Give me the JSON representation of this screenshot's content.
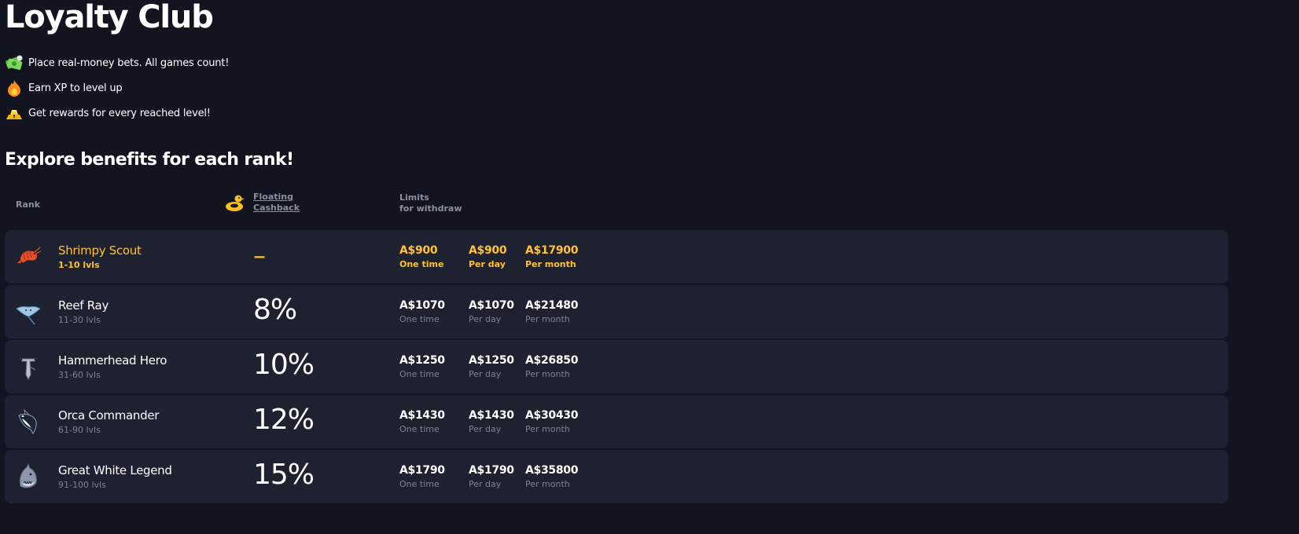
{
  "page": {
    "title": "Loyalty Club",
    "features": [
      {
        "icon": "money-stack-icon",
        "text": "Place real-money bets. All games count!"
      },
      {
        "icon": "flame-icon",
        "text": "Earn XP to level up"
      },
      {
        "icon": "gold-bars-icon",
        "text": "Get rewards for every reached level!"
      }
    ],
    "subtitle": "Explore benefits for each rank!"
  },
  "table": {
    "headers": {
      "rank": "Rank",
      "cashback_line1": "Floating",
      "cashback_line2": "Cashback",
      "limits_line1": "Limits",
      "limits_line2": "for withdraw"
    },
    "rows": [
      {
        "icon": "shrimp-icon",
        "name": "Shrimpy Scout",
        "levels": "1-10 lvls",
        "cashback": "–",
        "one_time": "A$900",
        "one_time_label": "One time",
        "per_day": "A$900",
        "per_day_label": "Per day",
        "per_month": "A$17900",
        "per_month_label": "Per month",
        "active": true
      },
      {
        "icon": "stingray-icon",
        "name": "Reef Ray",
        "levels": "11-30 lvls",
        "cashback": "8%",
        "one_time": "A$1070",
        "one_time_label": "One time",
        "per_day": "A$1070",
        "per_day_label": "Per day",
        "per_month": "A$21480",
        "per_month_label": "Per month"
      },
      {
        "icon": "hammerhead-shark-icon",
        "name": "Hammerhead Hero",
        "levels": "31-60 lvls",
        "cashback": "10%",
        "one_time": "A$1250",
        "one_time_label": "One time",
        "per_day": "A$1250",
        "per_day_label": "Per day",
        "per_month": "A$26850",
        "per_month_label": "Per month"
      },
      {
        "icon": "orca-icon",
        "name": "Orca Commander",
        "levels": "61-90 lvls",
        "cashback": "12%",
        "one_time": "A$1430",
        "one_time_label": "One time",
        "per_day": "A$1430",
        "per_day_label": "Per day",
        "per_month": "A$30430",
        "per_month_label": "Per month"
      },
      {
        "icon": "great-white-shark-icon",
        "name": "Great White Legend",
        "levels": "91-100 lvls",
        "cashback": "15%",
        "one_time": "A$1790",
        "one_time_label": "One time",
        "per_day": "A$1790",
        "per_day_label": "Per day",
        "per_month": "A$35800",
        "per_month_label": "Per month"
      }
    ]
  },
  "colors": {
    "background": "#12151f",
    "row_background": "#1e2130",
    "accent": "#ffc233",
    "muted": "#7d8294"
  }
}
